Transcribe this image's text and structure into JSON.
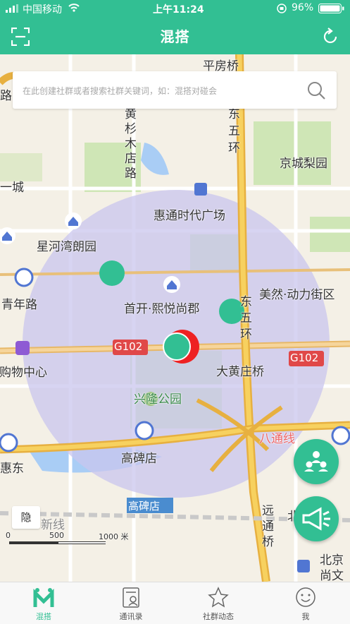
{
  "status_bar": {
    "carrier": "中国移动",
    "time": "上午11:24",
    "battery": "96%"
  },
  "nav": {
    "title": "混搭"
  },
  "search": {
    "placeholder": "在此创建社群或者搜索社群关键词，如：混搭对碰会"
  },
  "map": {
    "labels": {
      "pingfangqiao": "平房桥",
      "huangshan": "黄杉木店路",
      "east5": "东五环",
      "jingcheng": "京城梨园",
      "cheng": "一城",
      "huitong": "惠通时代广场",
      "xinghe": "星河湾朗园",
      "qingnian": "青年路",
      "ranran": "美然·动力街区",
      "shoukai": "首开·熙悦尚郡",
      "east5b": "东五环",
      "g102a": "G102",
      "g102b": "G102",
      "gouwu": "东购物中心",
      "dahuang": "大黄庄桥",
      "xinglong": "兴隆公园",
      "batong": "八通线",
      "gaobeidian": "高碑店",
      "huidong": "惠东",
      "gaobeidian2": "高碑店",
      "xinxian": "新线",
      "yuantong": "远通桥",
      "beijing": "北京",
      "shangwen": "尚文",
      "lu": "路",
      "bei": "北",
      "scale0": "0",
      "scale500": "500",
      "scale1000": "1000 米"
    },
    "hide_button": "隐"
  },
  "tabs": [
    {
      "label": "混搭",
      "icon": "mashup-icon"
    },
    {
      "label": "通讯录",
      "icon": "contacts-icon"
    },
    {
      "label": "社群动态",
      "icon": "star-icon"
    },
    {
      "label": "我",
      "icon": "profile-icon"
    }
  ],
  "colors": {
    "accent": "#32bf93",
    "circle": "#c9c6ee"
  }
}
